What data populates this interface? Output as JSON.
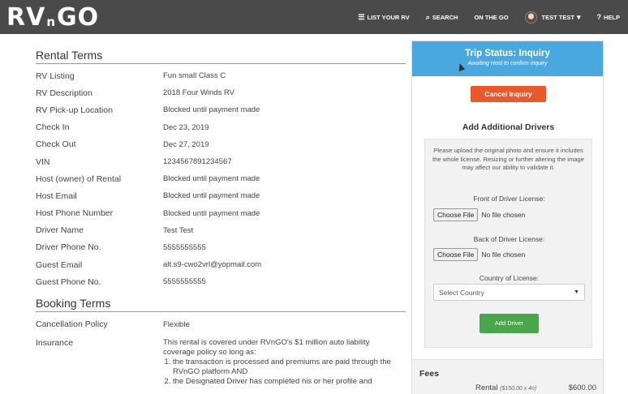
{
  "header": {
    "logo_left": "RV",
    "logo_mid": "n",
    "logo_right": "GO",
    "nav": [
      {
        "icon": "list-icon",
        "glyph": "☰",
        "label": "LIST YOUR RV"
      },
      {
        "icon": "search-icon",
        "glyph": "⌕",
        "label": "SEARCH"
      },
      {
        "label": "ON THE GO"
      },
      {
        "icon": "avatar",
        "label": "TEST TEST"
      },
      {
        "icon": "help-icon",
        "glyph": "?",
        "label": "HELP"
      }
    ]
  },
  "rental_terms": {
    "title": "Rental Terms",
    "rows": [
      {
        "label": "RV Listing",
        "value": "Fun small Class C"
      },
      {
        "label": "RV Description",
        "value": "2018 Four Winds RV"
      },
      {
        "label": "RV Pick-up Location",
        "value": "Blocked until payment made"
      },
      {
        "label": "Check In",
        "value": "Dec 23, 2019"
      },
      {
        "label": "Check Out",
        "value": "Dec 27, 2019"
      },
      {
        "label": "VIN",
        "value": "1234567891234567"
      },
      {
        "label": "Host (owner) of Rental",
        "value": "Blocked until payment made"
      },
      {
        "label": "Host Email",
        "value": "Blocked until payment made"
      },
      {
        "label": "Host Phone Number",
        "value": "Blocked until payment made"
      },
      {
        "label": "Driver Name",
        "value": "Test Test"
      },
      {
        "label": "Driver Phone No.",
        "value": "5555555555"
      },
      {
        "label": "Guest Email",
        "value": "alt.s9-cwo2vrl@yopmail.com"
      },
      {
        "label": "Guest Phone No.",
        "value": "5555555555"
      }
    ]
  },
  "booking_terms": {
    "title": "Booking Terms",
    "cancellation_label": "Cancellation Policy",
    "cancellation_value": "Flexible",
    "insurance_label": "Insurance",
    "insurance_intro": "This rental is covered under RVnGO's $1 million auto liability coverage policy so long as:",
    "insurance_items": [
      "the transaction is processed and premiums are paid through the RVnGO platform AND",
      "the Designated Driver has completed his or her profile and"
    ]
  },
  "trip": {
    "status_title": "Trip Status: Inquiry",
    "status_sub": "Awaiting Host to confirm inquiry",
    "cancel_label": "Cancel Inquiry",
    "add_drivers_title": "Add Additional Drivers",
    "note": "Please upload the original photo and ensure it includes the whole license. Resizing or further altering the image may affect our ability to validate it.",
    "front_label": "Front of Driver License:",
    "back_label": "Back of Driver License:",
    "choose_file": "Choose File",
    "no_file": "No file chosen",
    "country_label": "Country of License:",
    "country_placeholder": "Select Country",
    "add_driver_label": "Add Driver",
    "fees_title": "Fees",
    "fee_rental_label": "Rental",
    "fee_rental_detail": "($150.00 x 4n)",
    "fee_rental_value": "$600.00"
  }
}
